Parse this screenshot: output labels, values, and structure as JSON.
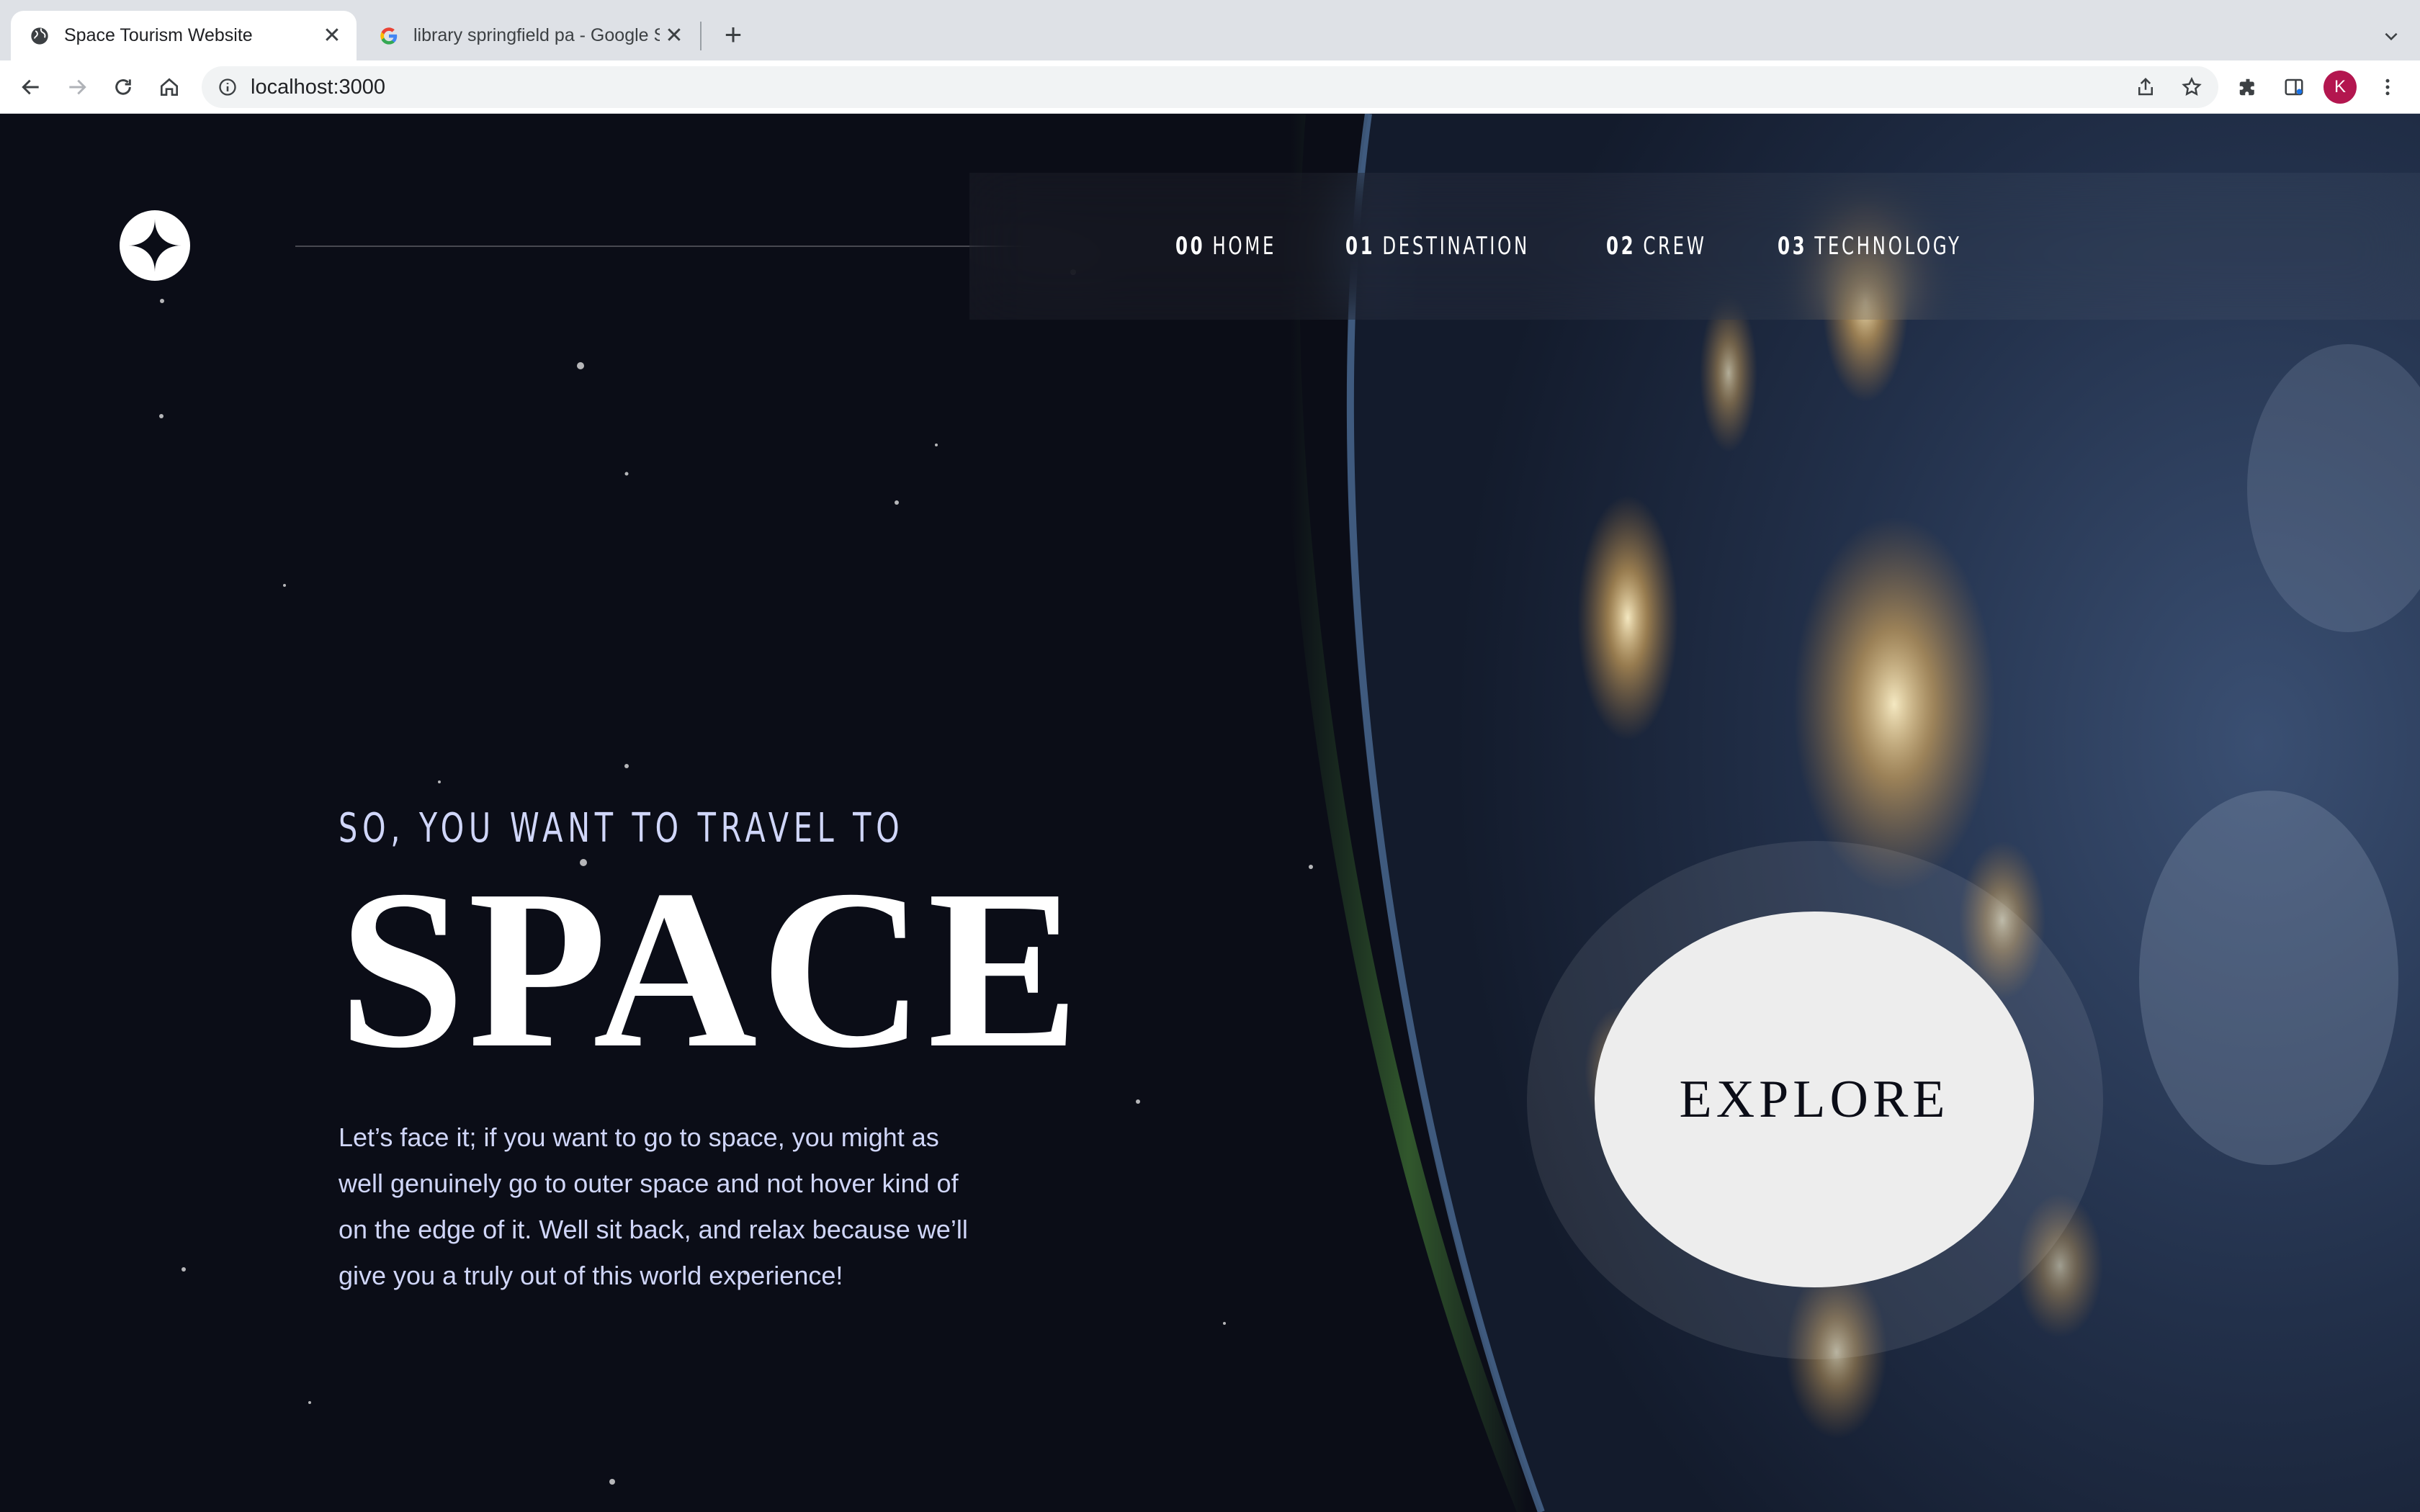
{
  "browser": {
    "tabs": [
      {
        "title": "Space Tourism Website",
        "active": true,
        "icon": "globe-icon"
      },
      {
        "title": "library springfield pa - Google S",
        "active": false,
        "icon": "google-icon"
      }
    ],
    "url": "localhost:3000",
    "profile_initial": "K",
    "profile_color": "#b3164f"
  },
  "site": {
    "nav": [
      {
        "num": "00",
        "label": "HOME"
      },
      {
        "num": "01",
        "label": "DESTINATION"
      },
      {
        "num": "02",
        "label": "CREW"
      },
      {
        "num": "03",
        "label": "TECHNOLOGY"
      }
    ],
    "hero": {
      "subtitle": "SO, YOU WANT TO TRAVEL TO",
      "headline": "SPACE",
      "body": "Let’s face it; if you want to go to space, you might as well genuinely go to outer space and not hover kind of on the edge of it. Well sit back, and relax because we’ll give you a truly out of this world experience!",
      "cta": "EXPLORE"
    },
    "colors": {
      "background": "#0b0d17",
      "accent_text": "#d0d6f9",
      "button": "#ededed"
    }
  }
}
